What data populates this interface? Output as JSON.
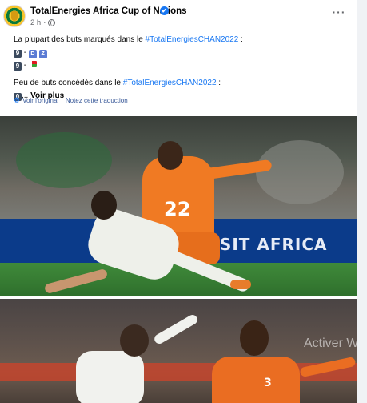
{
  "post": {
    "page_name": "TotalEnergies Africa Cup of Nations",
    "verified_mark": "✔",
    "time": "2 h",
    "dot": "·",
    "more": "···",
    "line1_prefix": "La plupart des buts marqués dans le ",
    "line1_hashtag": "#TotalEnergiesCHAN2022",
    "line1_suffix": " :",
    "row1_number": "9",
    "row1_sep": " - ",
    "row1_flag_letters": [
      "D",
      "Z"
    ],
    "row2_number": "9",
    "row2_sep": " - ",
    "line2_prefix": "Peu de buts concédés dans le ",
    "line2_hashtag": "#TotalEnergiesCHAN2022",
    "line2_suffix": " :",
    "row3_number": "0",
    "ellipsis": "... ",
    "see_more": "Voir plus",
    "see_original": "Voir l'original",
    "rate_translation": "Notez cette traduction",
    "translate_sep": " · "
  },
  "photo1": {
    "jersey_number": "22",
    "adboard": "VISIT AFRICA"
  },
  "photo2": {
    "jersey_number": "3"
  },
  "overlay": {
    "watermark": "Activer W"
  },
  "colors": {
    "link": "#1877f2",
    "secondary_text": "#65676b",
    "keycap": "#3b4a5e"
  }
}
